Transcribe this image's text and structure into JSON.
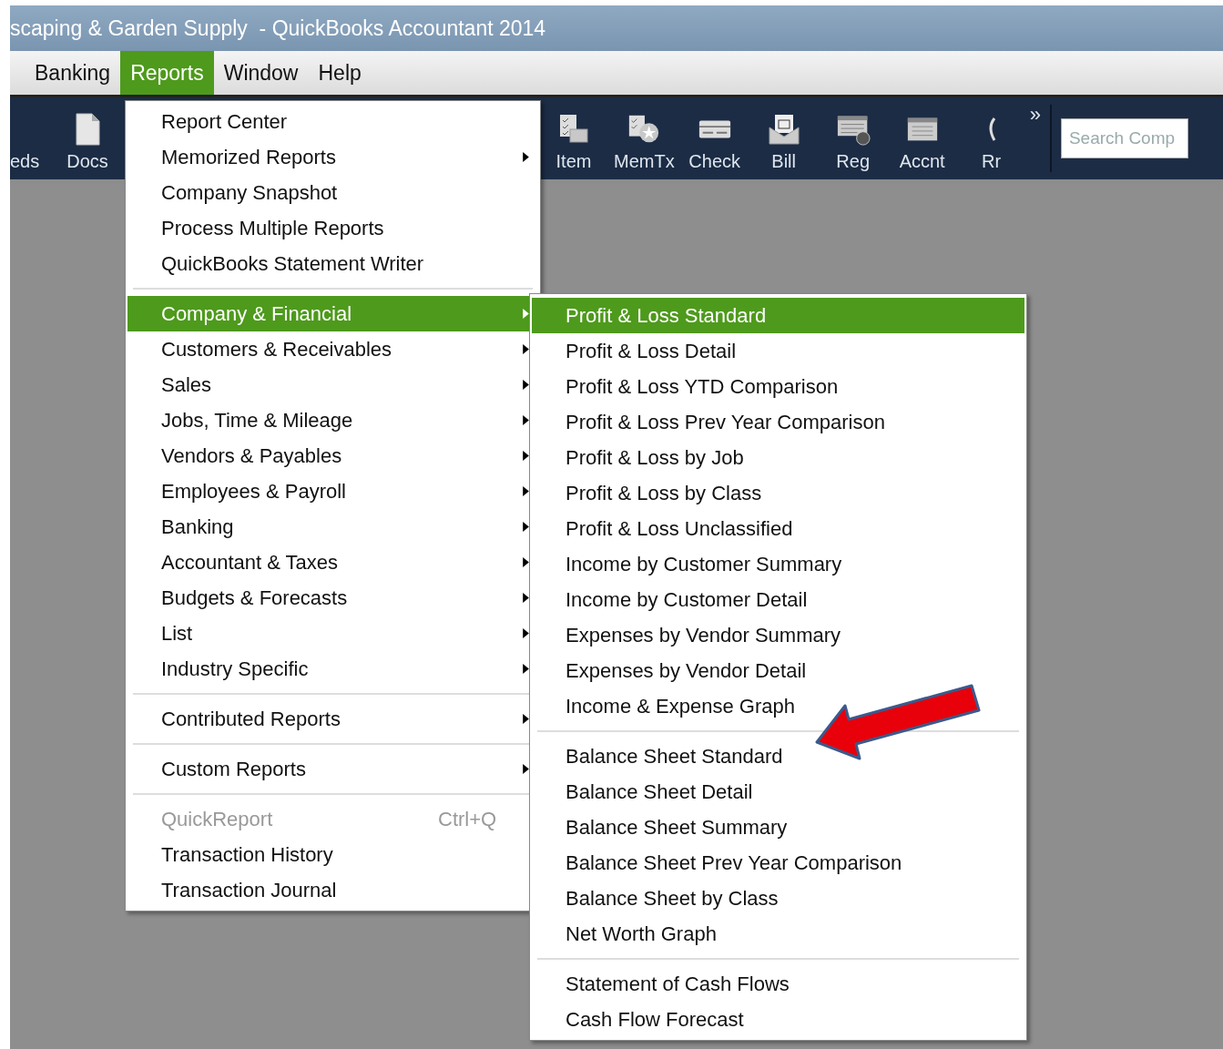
{
  "window": {
    "title": "scaping & Garden Supply  - QuickBooks Accountant 2014"
  },
  "menubar": [
    {
      "label": "Banking",
      "selected": false
    },
    {
      "label": "Reports",
      "selected": true
    },
    {
      "label": "Window",
      "selected": false
    },
    {
      "label": "Help",
      "selected": false
    }
  ],
  "toolbar_left": [
    {
      "label": "eds"
    },
    {
      "label": "Docs"
    }
  ],
  "toolbar_right": [
    {
      "label": "Item"
    },
    {
      "label": "MemTx"
    },
    {
      "label": "Check"
    },
    {
      "label": "Bill"
    },
    {
      "label": "Reg"
    },
    {
      "label": "Accnt"
    },
    {
      "label": "Rr"
    }
  ],
  "toolbar_more": "»",
  "search": {
    "placeholder": "Search Comp"
  },
  "reports_menu": [
    [
      {
        "label": "Report Center",
        "submenu": false,
        "selected": false,
        "disabled": false
      },
      {
        "label": "Memorized Reports",
        "submenu": true,
        "selected": false,
        "disabled": false
      },
      {
        "label": "Company Snapshot",
        "submenu": false,
        "selected": false,
        "disabled": false
      },
      {
        "label": "Process Multiple Reports",
        "submenu": false,
        "selected": false,
        "disabled": false
      },
      {
        "label": "QuickBooks Statement Writer",
        "submenu": false,
        "selected": false,
        "disabled": false
      }
    ],
    [
      {
        "label": "Company & Financial",
        "submenu": true,
        "selected": true,
        "disabled": false
      },
      {
        "label": "Customers & Receivables",
        "submenu": true,
        "selected": false,
        "disabled": false
      },
      {
        "label": "Sales",
        "submenu": true,
        "selected": false,
        "disabled": false
      },
      {
        "label": "Jobs, Time & Mileage",
        "submenu": true,
        "selected": false,
        "disabled": false
      },
      {
        "label": "Vendors & Payables",
        "submenu": true,
        "selected": false,
        "disabled": false
      },
      {
        "label": "Employees & Payroll",
        "submenu": true,
        "selected": false,
        "disabled": false
      },
      {
        "label": "Banking",
        "submenu": true,
        "selected": false,
        "disabled": false
      },
      {
        "label": "Accountant & Taxes",
        "submenu": true,
        "selected": false,
        "disabled": false
      },
      {
        "label": "Budgets & Forecasts",
        "submenu": true,
        "selected": false,
        "disabled": false
      },
      {
        "label": "List",
        "submenu": true,
        "selected": false,
        "disabled": false
      },
      {
        "label": "Industry Specific",
        "submenu": true,
        "selected": false,
        "disabled": false
      }
    ],
    [
      {
        "label": "Contributed Reports",
        "submenu": true,
        "selected": false,
        "disabled": false
      }
    ],
    [
      {
        "label": "Custom Reports",
        "submenu": true,
        "selected": false,
        "disabled": false
      }
    ],
    [
      {
        "label": "QuickReport",
        "shortcut": "Ctrl+Q",
        "submenu": false,
        "selected": false,
        "disabled": true
      },
      {
        "label": "Transaction History",
        "submenu": false,
        "selected": false,
        "disabled": false
      },
      {
        "label": "Transaction Journal",
        "submenu": false,
        "selected": false,
        "disabled": false
      }
    ]
  ],
  "company_financial_submenu": [
    [
      {
        "label": "Profit & Loss Standard",
        "selected": true
      },
      {
        "label": "Profit & Loss Detail",
        "selected": false
      },
      {
        "label": "Profit & Loss YTD Comparison",
        "selected": false
      },
      {
        "label": "Profit & Loss Prev Year Comparison",
        "selected": false
      },
      {
        "label": "Profit & Loss by Job",
        "selected": false
      },
      {
        "label": "Profit & Loss by Class",
        "selected": false
      },
      {
        "label": "Profit & Loss Unclassified",
        "selected": false
      },
      {
        "label": "Income by Customer Summary",
        "selected": false
      },
      {
        "label": "Income by Customer Detail",
        "selected": false
      },
      {
        "label": "Expenses by Vendor Summary",
        "selected": false
      },
      {
        "label": "Expenses by Vendor Detail",
        "selected": false
      },
      {
        "label": "Income & Expense Graph",
        "selected": false
      }
    ],
    [
      {
        "label": "Balance Sheet Standard",
        "selected": false
      },
      {
        "label": "Balance Sheet Detail",
        "selected": false
      },
      {
        "label": "Balance Sheet Summary",
        "selected": false
      },
      {
        "label": "Balance Sheet Prev Year Comparison",
        "selected": false
      },
      {
        "label": "Balance Sheet by Class",
        "selected": false
      },
      {
        "label": "Net Worth Graph",
        "selected": false
      }
    ],
    [
      {
        "label": "Statement of Cash Flows",
        "selected": false
      },
      {
        "label": "Cash Flow Forecast",
        "selected": false
      }
    ]
  ]
}
